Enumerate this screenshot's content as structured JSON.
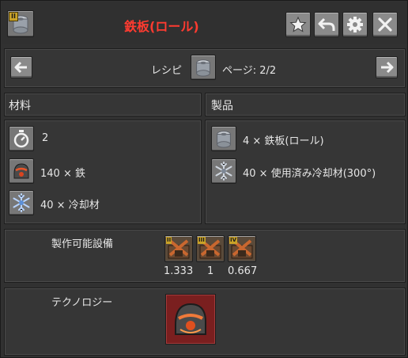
{
  "header": {
    "title": "鉄板(ロール)",
    "title_color": "#ff3b30",
    "icon": "rolled-iron-plate-icon",
    "tier_badge": "II",
    "buttons": [
      "star-icon",
      "back-arrow-icon",
      "gear-icon",
      "close-icon"
    ]
  },
  "nav": {
    "label": "レシピ",
    "page_text": "ページ: 2/2",
    "icon": "rolled-iron-plate-icon"
  },
  "ingredients": {
    "header": "材料",
    "items": [
      {
        "icon": "timer-icon",
        "text": "2"
      },
      {
        "icon": "iron-ore-icon",
        "text": "140 × 鉄"
      },
      {
        "icon": "coolant-snowflake-icon",
        "text": "40 × 冷却材"
      }
    ]
  },
  "products": {
    "header": "製品",
    "items": [
      {
        "icon": "rolled-iron-plate-icon",
        "text": "4 × 鉄板(ロール)"
      },
      {
        "icon": "used-coolant-snowflake-icon",
        "text": "40 × 使用済み冷却材(300°)"
      }
    ]
  },
  "machines": {
    "label": "製作可能設備",
    "items": [
      {
        "tier": "II",
        "speed": "1.333"
      },
      {
        "tier": "III",
        "speed": "1"
      },
      {
        "tier": "IV",
        "speed": "0.667"
      }
    ]
  },
  "technology": {
    "label": "テクノロジー",
    "icon": "metallurgy-tech-icon",
    "bg_color": "#7a1f1f"
  }
}
